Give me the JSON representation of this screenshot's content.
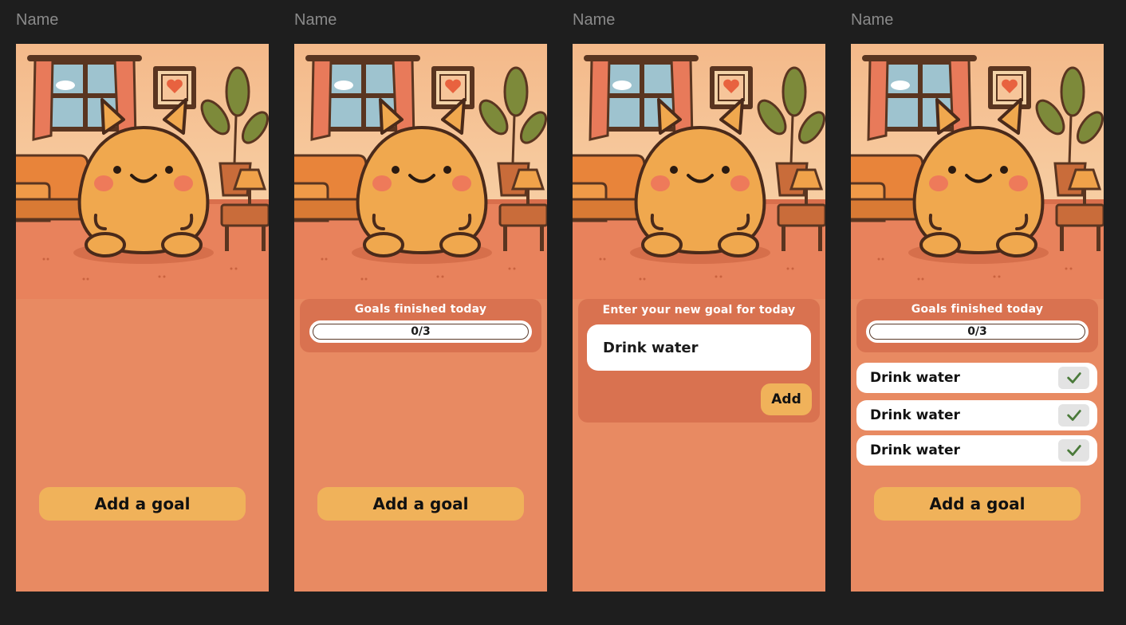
{
  "frames": [
    {
      "name": "Name"
    },
    {
      "name": "Name"
    },
    {
      "name": "Name"
    },
    {
      "name": "Name"
    }
  ],
  "progress_card": {
    "title": "Goals finished today",
    "progress_text": "0/3"
  },
  "add_goal_button": "Add a goal",
  "new_goal_card": {
    "title": "Enter your new goal for today",
    "input_value": "Drink water",
    "add_label": "Add"
  },
  "goal_list": [
    {
      "label": "Drink water",
      "icon": "checkmark-icon"
    },
    {
      "label": "Drink water",
      "icon": "checkmark-icon"
    },
    {
      "label": "Drink water",
      "icon": "checkmark-icon"
    }
  ],
  "colors": {
    "canvas": "#1e1e1e",
    "screen_bg": "#e88a62",
    "card_bg": "#d97250",
    "button": "#f0b25a",
    "check": "#4a7a3a"
  }
}
